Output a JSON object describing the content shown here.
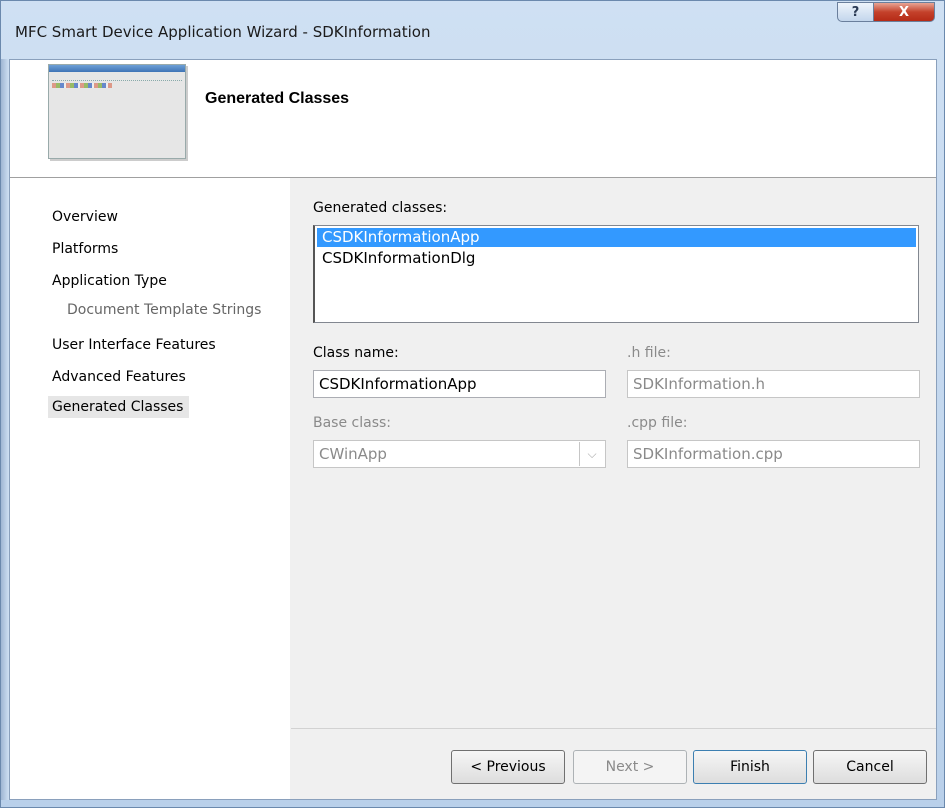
{
  "window": {
    "title": "MFC Smart Device Application Wizard - SDKInformation"
  },
  "titlebar": {
    "help_glyph": "?",
    "close_glyph": "X"
  },
  "header": {
    "title": "Generated Classes"
  },
  "sidebar": {
    "items": [
      {
        "label": "Overview"
      },
      {
        "label": "Platforms"
      },
      {
        "label": "Application Type"
      },
      {
        "label": "Document Template Strings"
      },
      {
        "label": "User Interface Features"
      },
      {
        "label": "Advanced Features"
      },
      {
        "label": "Generated Classes"
      }
    ]
  },
  "main": {
    "generated_classes_label": "Generated classes:",
    "generated_classes": [
      "CSDKInformationApp",
      "CSDKInformationDlg"
    ],
    "class_name_label": "Class name:",
    "class_name_value": "CSDKInformationApp",
    "h_file_label": ".h file:",
    "h_file_value": "SDKInformation.h",
    "base_class_label": "Base class:",
    "base_class_value": "CWinApp",
    "cpp_file_label": ".cpp file:",
    "cpp_file_value": "SDKInformation.cpp"
  },
  "buttons": {
    "previous": "< Previous",
    "next": "Next >",
    "finish": "Finish",
    "cancel": "Cancel"
  },
  "colors": {
    "selection": "#3399ff",
    "close": "#c4412b"
  }
}
